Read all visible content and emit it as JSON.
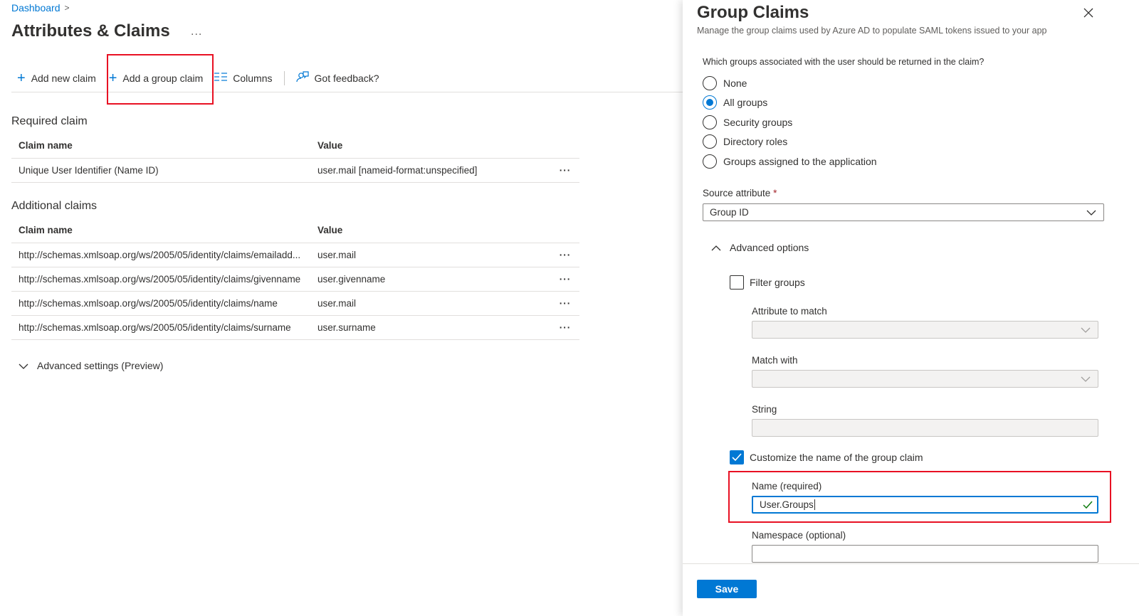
{
  "breadcrumb": {
    "root": "Dashboard",
    "separator": ">"
  },
  "page": {
    "title": "Attributes & Claims",
    "more": "..."
  },
  "toolbar": {
    "add_claim": "Add new claim",
    "add_group_claim": "Add a group claim",
    "columns": "Columns",
    "feedback": "Got feedback?"
  },
  "required": {
    "heading": "Required claim",
    "col_name": "Claim name",
    "col_value": "Value",
    "rows": [
      {
        "name": "Unique User Identifier (Name ID)",
        "value": "user.mail [nameid-format:unspecified]",
        "more": "···"
      }
    ]
  },
  "additional": {
    "heading": "Additional claims",
    "col_name": "Claim name",
    "col_value": "Value",
    "rows": [
      {
        "name": "http://schemas.xmlsoap.org/ws/2005/05/identity/claims/emailadd...",
        "value": "user.mail",
        "more": "···"
      },
      {
        "name": "http://schemas.xmlsoap.org/ws/2005/05/identity/claims/givenname",
        "value": "user.givenname",
        "more": "···"
      },
      {
        "name": "http://schemas.xmlsoap.org/ws/2005/05/identity/claims/name",
        "value": "user.mail",
        "more": "···"
      },
      {
        "name": "http://schemas.xmlsoap.org/ws/2005/05/identity/claims/surname",
        "value": "user.surname",
        "more": "···"
      }
    ]
  },
  "advanced_settings": "Advanced settings (Preview)",
  "panel": {
    "title": "Group Claims",
    "subtitle": "Manage the group claims used by Azure AD to populate SAML tokens issued to your app",
    "question": "Which groups associated with the user should be returned in the claim?",
    "options": [
      {
        "label": "None",
        "selected": false
      },
      {
        "label": "All groups",
        "selected": true
      },
      {
        "label": "Security groups",
        "selected": false
      },
      {
        "label": "Directory roles",
        "selected": false
      },
      {
        "label": "Groups assigned to the application",
        "selected": false
      }
    ],
    "source_attribute_label": "Source attribute",
    "source_attribute_required": "*",
    "source_attribute_value": "Group ID",
    "advanced_options": "Advanced options",
    "filter_groups": "Filter groups",
    "filter_groups_checked": false,
    "attribute_to_match": "Attribute to match",
    "match_with": "Match with",
    "string": "String",
    "customize_name": "Customize the name of the group claim",
    "customize_name_checked": true,
    "name_label": "Name (required)",
    "name_value": "User.Groups",
    "namespace_label": "Namespace (optional)",
    "namespace_value": "",
    "save": "Save"
  },
  "colors": {
    "accent": "#0078d4",
    "highlight": "#e81123",
    "success": "#107c10"
  }
}
